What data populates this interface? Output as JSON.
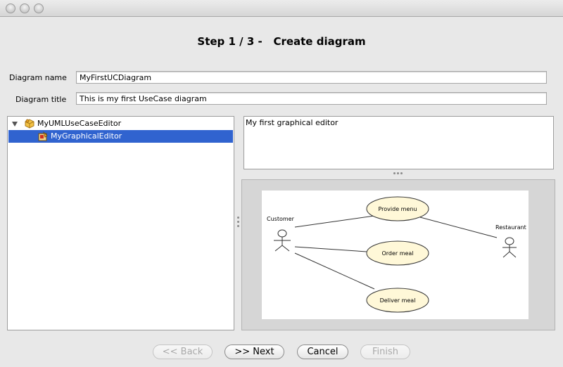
{
  "wizard": {
    "step_label": "Step 1 / 3 -",
    "step_title": "Create diagram"
  },
  "form": {
    "diagram_name_label": "Diagram name",
    "diagram_name_value": "MyFirstUCDiagram",
    "diagram_title_label": "Diagram title",
    "diagram_title_value": "This is my first UseCase diagram"
  },
  "tree": {
    "root_label": "MyUMLUseCaseEditor",
    "root_icon": "package-icon",
    "child_label": "MyGraphicalEditor",
    "child_icon": "graphical-editor-icon",
    "selected_color": "#3063cf"
  },
  "description": {
    "text": "My first graphical editor"
  },
  "preview": {
    "actors": [
      "Customer",
      "Restaurant"
    ],
    "use_cases": [
      "Provide menu",
      "Order meal",
      "Deliver meal"
    ],
    "use_case_fill": "#fff8d8"
  },
  "buttons": {
    "back": "<< Back",
    "next": ">> Next",
    "cancel": "Cancel",
    "finish": "Finish"
  }
}
